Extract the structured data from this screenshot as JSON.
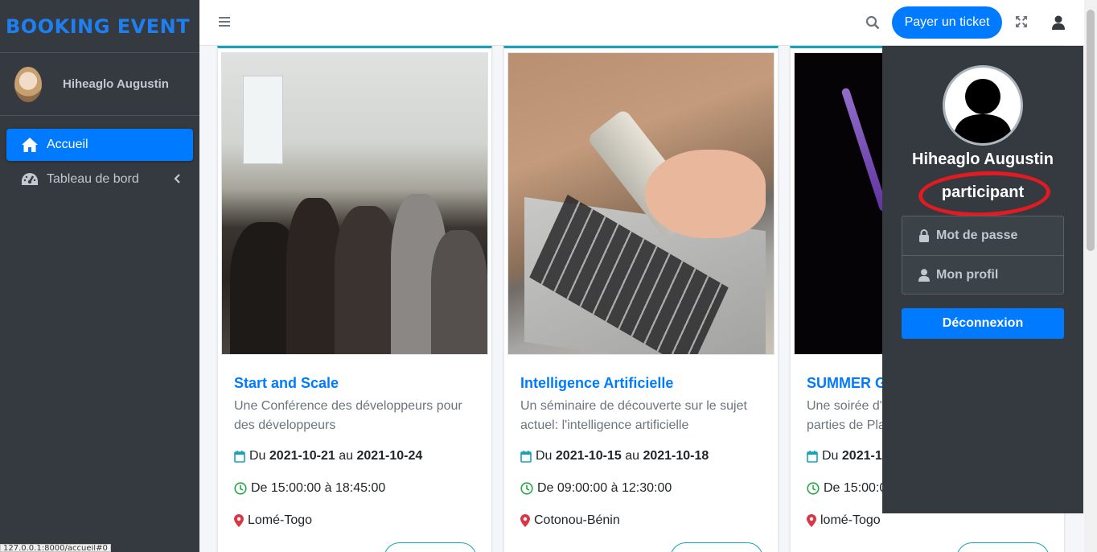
{
  "brand": {
    "title": "BOOKING EVENT"
  },
  "sidebar": {
    "user_name": "Hiheaglo Augustin",
    "items": [
      {
        "label": "Accueil",
        "icon": "home-icon",
        "active": true
      },
      {
        "label": "Tableau de bord",
        "icon": "dashboard-icon",
        "active": false
      }
    ]
  },
  "topbar": {
    "pay_label": "Payer un ticket"
  },
  "events": [
    {
      "title": "Start and Scale",
      "description": "Une Conférence des développeurs pour des développeurs",
      "date_prefix": "Du",
      "date_start": "2021-10-21",
      "date_sep": "au",
      "date_end": "2021-10-24",
      "time": "De 15:00:00 à 18:45:00",
      "location": "Lomé-Togo"
    },
    {
      "title": "Intelligence Artificielle",
      "description": "Un séminaire de découverte sur le sujet actuel: l'intelligence artificielle",
      "date_prefix": "Du",
      "date_start": "2021-10-15",
      "date_sep": "au",
      "date_end": "2021-10-18",
      "time": "De 09:00:00 à 12:30:00",
      "location": "Cotonou-Bénin"
    },
    {
      "title": "SUMMER G",
      "description": "Une soirée d'",
      "description2": "parties de Pla",
      "date_prefix": "Du",
      "date_start": "2021-1",
      "time": "De 15:00:0",
      "location": "lomé-Togo"
    }
  ],
  "user_menu": {
    "name": "Hiheaglo Augustin",
    "role": "participant",
    "items": [
      {
        "label": "Mot de passe",
        "icon": "lock-icon"
      },
      {
        "label": "Mon profil",
        "icon": "user-icon"
      }
    ],
    "logout_label": "Déconnexion"
  },
  "status_url": "127.0.0.1:8000/accueil#0",
  "colors": {
    "primary": "#007bff",
    "sidebar": "#343a40",
    "accent_border": "#17a2b8",
    "highlight": "#e21a22"
  }
}
